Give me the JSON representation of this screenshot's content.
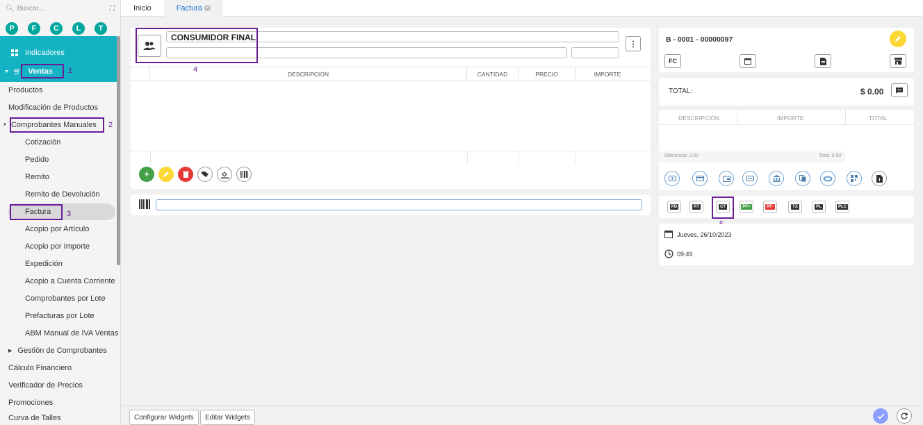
{
  "sidebar": {
    "search_placeholder": "Buscar...",
    "quick_letters": [
      "P",
      "F",
      "C",
      "L",
      "T"
    ],
    "indicadores": "Indicadores",
    "ventas": "Ventas",
    "items": {
      "productos": "Productos",
      "modificacion": "Modificación de Productos",
      "comprobantes_manuales": "Comprobantes Manuales",
      "cotizacion": "Cotización",
      "pedido": "Pedido",
      "remito": "Remito",
      "remito_devolucion": "Remito de Devolución",
      "factura": "Factura",
      "acopio_articulo": "Acopio por Artículo",
      "acopio_importe": "Acopio por Importe",
      "expedicion": "Expedición",
      "acopio_cc": "Acopio a Cuenta Corriente",
      "comprobantes_lote": "Comprobantes por Lote",
      "prefacturas_lote": "Prefacturas por Lote",
      "abm_iva": "ABM Manual de IVA Ventas",
      "gestion": "Gestión de Comprobantes",
      "calculo": "Cálculo Financiero",
      "verificador": "Verificador de Precios",
      "promociones": "Promociones",
      "curva": "Curva de Talles"
    }
  },
  "annotations": {
    "n1": "1",
    "n2": "2",
    "n3": "3",
    "n4": "4",
    "n5": "5"
  },
  "tabs": {
    "inicio": "Inicio",
    "factura": "Factura"
  },
  "client": {
    "name": "CONSUMIDOR FINAL"
  },
  "table": {
    "descripcion": "DESCRIPCIÓN",
    "cantidad": "CANTIDAD",
    "precio": "PRECIO",
    "importe": "IMPORTE"
  },
  "invoice": {
    "number": "B - 0001 - 00000097",
    "type": "FC",
    "total_label": "TOTAL:",
    "total_value": "$ 0.00"
  },
  "payments": {
    "descripcion": "DESCRIPCIÓN",
    "importe": "IMPORTE",
    "total": "TOTAL",
    "diferencia": "Diferencia: 0.00",
    "total_footer": "Total: 0.00"
  },
  "doc_buttons": [
    "PD",
    "RT",
    "CT",
    "PF+",
    "PF-",
    "TX",
    "PL",
    "PLC"
  ],
  "datetime": {
    "date": "Jueves, 26/10/2023",
    "time": "09:49"
  },
  "bottom": {
    "configurar": "Configurar Widgets",
    "editar": "Editar Widgets"
  },
  "colors": {
    "teal": "#14b3c4",
    "green_circle": "#00a79d",
    "purple": "#6a1b9a",
    "blue": "#1976d2"
  }
}
